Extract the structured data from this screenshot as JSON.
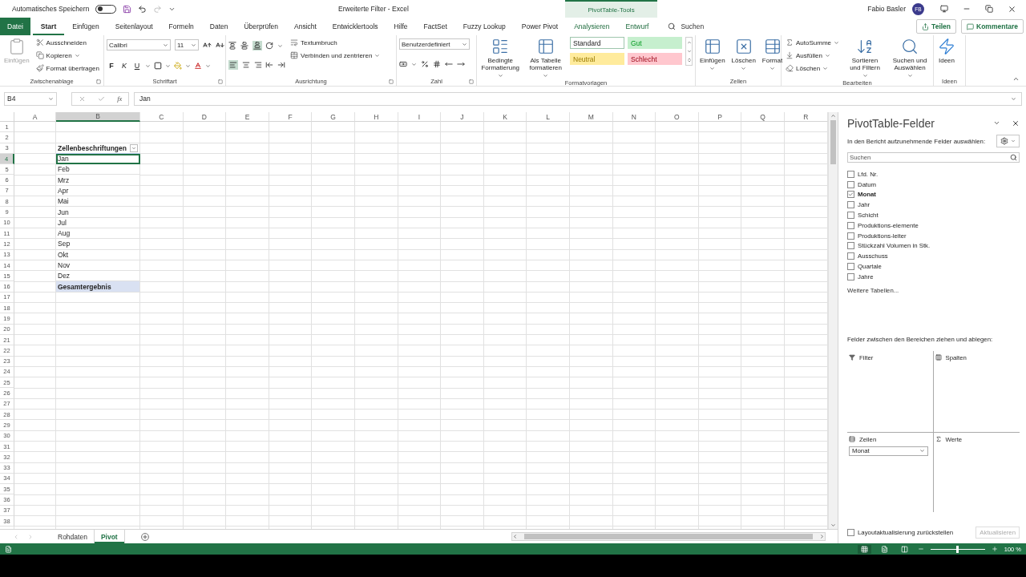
{
  "title_bar": {
    "autosave_label": "Automatisches Speichern",
    "autosave_on": false,
    "document_title": "Erweiterte Filter  -  Excel",
    "context_tab": "PivotTable-Tools",
    "user": "Fabio Basler",
    "avatar": "FB"
  },
  "ribbon_tabs": [
    {
      "label": "Datei",
      "kind": "file",
      "selected": false
    },
    {
      "label": "Start",
      "kind": "normal",
      "selected": true
    },
    {
      "label": "Einfügen",
      "kind": "normal",
      "selected": false
    },
    {
      "label": "Seitenlayout",
      "kind": "normal",
      "selected": false
    },
    {
      "label": "Formeln",
      "kind": "normal",
      "selected": false
    },
    {
      "label": "Daten",
      "kind": "normal",
      "selected": false
    },
    {
      "label": "Überprüfen",
      "kind": "normal",
      "selected": false
    },
    {
      "label": "Ansicht",
      "kind": "normal",
      "selected": false
    },
    {
      "label": "Entwicklertools",
      "kind": "normal",
      "selected": false
    },
    {
      "label": "Hilfe",
      "kind": "normal",
      "selected": false
    },
    {
      "label": "FactSet",
      "kind": "normal",
      "selected": false
    },
    {
      "label": "Fuzzy Lookup",
      "kind": "normal",
      "selected": false
    },
    {
      "label": "Power Pivot",
      "kind": "normal",
      "selected": false
    },
    {
      "label": "Analysieren",
      "kind": "context",
      "selected": false
    },
    {
      "label": "Entwurf",
      "kind": "context",
      "selected": false
    }
  ],
  "tell_me": "Suchen",
  "share_button": "Teilen",
  "comments_button": "Kommentare",
  "ribbon_groups": [
    {
      "label": "Zwischenablage",
      "launcher": true,
      "columns": [
        [
          {
            "kind": "large",
            "label": "Einfügen",
            "disabled": true
          }
        ],
        [
          {
            "kind": "small",
            "label": "Ausschneiden",
            "disabled": false
          },
          {
            "kind": "small_menu",
            "label": "Kopieren",
            "disabled": false
          },
          {
            "kind": "small",
            "label": "Format übertragen",
            "disabled": false
          }
        ]
      ]
    },
    {
      "label": "Schriftart",
      "launcher": true,
      "columns": [
        [
          {
            "kind": "font_row",
            "font": "Calibri",
            "size": "11"
          },
          {
            "kind": "format_row",
            "labels": [
              "F",
              "K",
              "U"
            ]
          }
        ]
      ]
    },
    {
      "label": "Ausrichtung",
      "launcher": true,
      "columns": [
        [
          {
            "kind": "valign_row"
          },
          {
            "kind": "halign_row"
          }
        ],
        [
          {
            "kind": "orient_row"
          },
          {
            "kind": "indent_row"
          }
        ],
        [
          {
            "kind": "small",
            "label": "Textumbruch"
          },
          {
            "kind": "small_menu",
            "label": "Verbinden und zentrieren"
          }
        ]
      ]
    },
    {
      "label": "Zahl",
      "launcher": true,
      "columns": [
        [
          {
            "kind": "combo",
            "label": "Benutzerdefiniert"
          },
          {
            "kind": "number_row"
          }
        ]
      ]
    },
    {
      "label": "Formatvorlagen",
      "launcher": false,
      "columns": [
        [
          {
            "kind": "large_menu",
            "label": "Bedingte Formatierung"
          }
        ],
        [
          {
            "kind": "large_menu",
            "label": "Als Tabelle formatieren"
          }
        ],
        [
          {
            "kind": "style",
            "label": "Standard",
            "color": "#ffffff",
            "selected": true
          },
          {
            "kind": "style",
            "label": "Neutral",
            "color": "#ffeb9c",
            "selected": false
          }
        ],
        [
          {
            "kind": "style",
            "label": "Gut",
            "color": "#c6efce",
            "selected": false
          },
          {
            "kind": "style",
            "label": "Schlecht",
            "color": "#ffc7ce",
            "selected": false
          }
        ],
        [
          {
            "kind": "gallery_scroll"
          }
        ]
      ]
    },
    {
      "label": "Zellen",
      "launcher": false,
      "columns": [
        [
          {
            "kind": "large_menu",
            "label": "Einfügen"
          }
        ],
        [
          {
            "kind": "large_menu",
            "label": "Löschen"
          }
        ],
        [
          {
            "kind": "large_menu",
            "label": "Format"
          }
        ]
      ]
    },
    {
      "label": "Bearbeiten",
      "launcher": false,
      "columns": [
        [
          {
            "kind": "small_menu",
            "label": "AutoSumme"
          },
          {
            "kind": "small_menu",
            "label": "Ausfüllen"
          },
          {
            "kind": "small_menu",
            "label": "Löschen"
          }
        ],
        [
          {
            "kind": "large_menu",
            "label": "Sortieren und Filtern"
          }
        ],
        [
          {
            "kind": "large_menu",
            "label": "Suchen und Auswählen"
          }
        ]
      ]
    },
    {
      "label": "Ideen",
      "launcher": false,
      "columns": [
        [
          {
            "kind": "large",
            "label": "Ideen"
          }
        ]
      ]
    }
  ],
  "formula_bar": {
    "name_box": "B4",
    "fx": "fx",
    "value": "Jan"
  },
  "columns": [
    {
      "label": "A",
      "selected": false
    },
    {
      "label": "B",
      "selected": true
    },
    {
      "label": "C",
      "selected": false
    },
    {
      "label": "D",
      "selected": false
    },
    {
      "label": "E",
      "selected": false
    },
    {
      "label": "F",
      "selected": false
    },
    {
      "label": "G",
      "selected": false
    },
    {
      "label": "H",
      "selected": false
    },
    {
      "label": "I",
      "selected": false
    },
    {
      "label": "J",
      "selected": false
    },
    {
      "label": "K",
      "selected": false
    },
    {
      "label": "L",
      "selected": false
    },
    {
      "label": "M",
      "selected": false
    },
    {
      "label": "N",
      "selected": false
    },
    {
      "label": "O",
      "selected": false
    },
    {
      "label": "P",
      "selected": false
    },
    {
      "label": "Q",
      "selected": false
    },
    {
      "label": "R",
      "selected": false
    }
  ],
  "rows": [
    {
      "label": "1",
      "kind": "empty",
      "selected": false
    },
    {
      "label": "2",
      "kind": "empty",
      "selected": false
    },
    {
      "label": "3",
      "kind": "header",
      "cell": "Zellenbeschriftungen",
      "selected": false
    },
    {
      "label": "4",
      "kind": "item",
      "cell": "Jan",
      "selected": true
    },
    {
      "label": "5",
      "kind": "item",
      "cell": "Feb",
      "selected": false
    },
    {
      "label": "6",
      "kind": "item",
      "cell": "Mrz",
      "selected": false
    },
    {
      "label": "7",
      "kind": "item",
      "cell": "Apr",
      "selected": false
    },
    {
      "label": "8",
      "kind": "item",
      "cell": "Mai",
      "selected": false
    },
    {
      "label": "9",
      "kind": "item",
      "cell": "Jun",
      "selected": false
    },
    {
      "label": "10",
      "kind": "item",
      "cell": "Jul",
      "selected": false
    },
    {
      "label": "11",
      "kind": "item",
      "cell": "Aug",
      "selected": false
    },
    {
      "label": "12",
      "kind": "item",
      "cell": "Sep",
      "selected": false
    },
    {
      "label": "13",
      "kind": "item",
      "cell": "Okt",
      "selected": false
    },
    {
      "label": "14",
      "kind": "item",
      "cell": "Nov",
      "selected": false
    },
    {
      "label": "15",
      "kind": "item",
      "cell": "Dez",
      "selected": false
    },
    {
      "label": "16",
      "kind": "total",
      "cell": "Gesamtergebnis",
      "selected": false
    },
    {
      "label": "17",
      "kind": "empty",
      "selected": false
    },
    {
      "label": "18",
      "kind": "empty",
      "selected": false
    },
    {
      "label": "19",
      "kind": "empty",
      "selected": false
    },
    {
      "label": "20",
      "kind": "empty",
      "selected": false
    },
    {
      "label": "21",
      "kind": "empty",
      "selected": false
    },
    {
      "label": "22",
      "kind": "empty",
      "selected": false
    },
    {
      "label": "23",
      "kind": "empty",
      "selected": false
    },
    {
      "label": "24",
      "kind": "empty",
      "selected": false
    },
    {
      "label": "25",
      "kind": "empty",
      "selected": false
    },
    {
      "label": "26",
      "kind": "empty",
      "selected": false
    },
    {
      "label": "27",
      "kind": "empty",
      "selected": false
    },
    {
      "label": "28",
      "kind": "empty",
      "selected": false
    },
    {
      "label": "29",
      "kind": "empty",
      "selected": false
    },
    {
      "label": "30",
      "kind": "empty",
      "selected": false
    },
    {
      "label": "31",
      "kind": "empty",
      "selected": false
    },
    {
      "label": "32",
      "kind": "empty",
      "selected": false
    },
    {
      "label": "33",
      "kind": "empty",
      "selected": false
    },
    {
      "label": "34",
      "kind": "empty",
      "selected": false
    },
    {
      "label": "35",
      "kind": "empty",
      "selected": false
    },
    {
      "label": "36",
      "kind": "empty",
      "selected": false
    },
    {
      "label": "37",
      "kind": "empty",
      "selected": false
    },
    {
      "label": "38",
      "kind": "empty",
      "selected": false
    }
  ],
  "sheet_tabs": [
    {
      "label": "Rohdaten",
      "selected": false
    },
    {
      "label": "Pivot",
      "selected": true
    }
  ],
  "pivot_panel": {
    "title": "PivotTable-Felder",
    "subtitle": "In den Bericht aufzunehmende Felder auswählen:",
    "search_placeholder": "Suchen",
    "fields": [
      {
        "label": "Lfd. Nr.",
        "checked": false
      },
      {
        "label": "Datum",
        "checked": false
      },
      {
        "label": "Monat",
        "checked": true
      },
      {
        "label": "Jahr",
        "checked": false
      },
      {
        "label": "Schicht",
        "checked": false
      },
      {
        "label": "Produktions-elemente",
        "checked": false
      },
      {
        "label": "Produktions-leiter",
        "checked": false
      },
      {
        "label": "Stückzahl Volumen in Stk.",
        "checked": false
      },
      {
        "label": "Ausschuss",
        "checked": false
      },
      {
        "label": "Quartale",
        "checked": false
      },
      {
        "label": "Jahre",
        "checked": false
      }
    ],
    "more_tables": "Weitere Tabellen...",
    "areas_hint": "Felder zwischen den Bereichen ziehen und ablegen:",
    "areas": [
      {
        "label": "Filter",
        "kind": "filter"
      },
      {
        "label": "Spalten",
        "kind": "columns"
      },
      {
        "label": "Zeilen",
        "kind": "rows",
        "items": [
          "Monat"
        ]
      },
      {
        "label": "Werte",
        "kind": "values"
      }
    ],
    "defer_label": "Layoutaktualisierung zurückstellen",
    "defer_checked": false,
    "update_button": "Aktualisieren",
    "update_disabled": true
  },
  "status_bar": {
    "views": [
      {
        "selected": true
      },
      {
        "selected": false
      },
      {
        "selected": false
      }
    ],
    "zoom_slider": {
      "level": 0.48
    },
    "zoom_label": "100 %"
  }
}
